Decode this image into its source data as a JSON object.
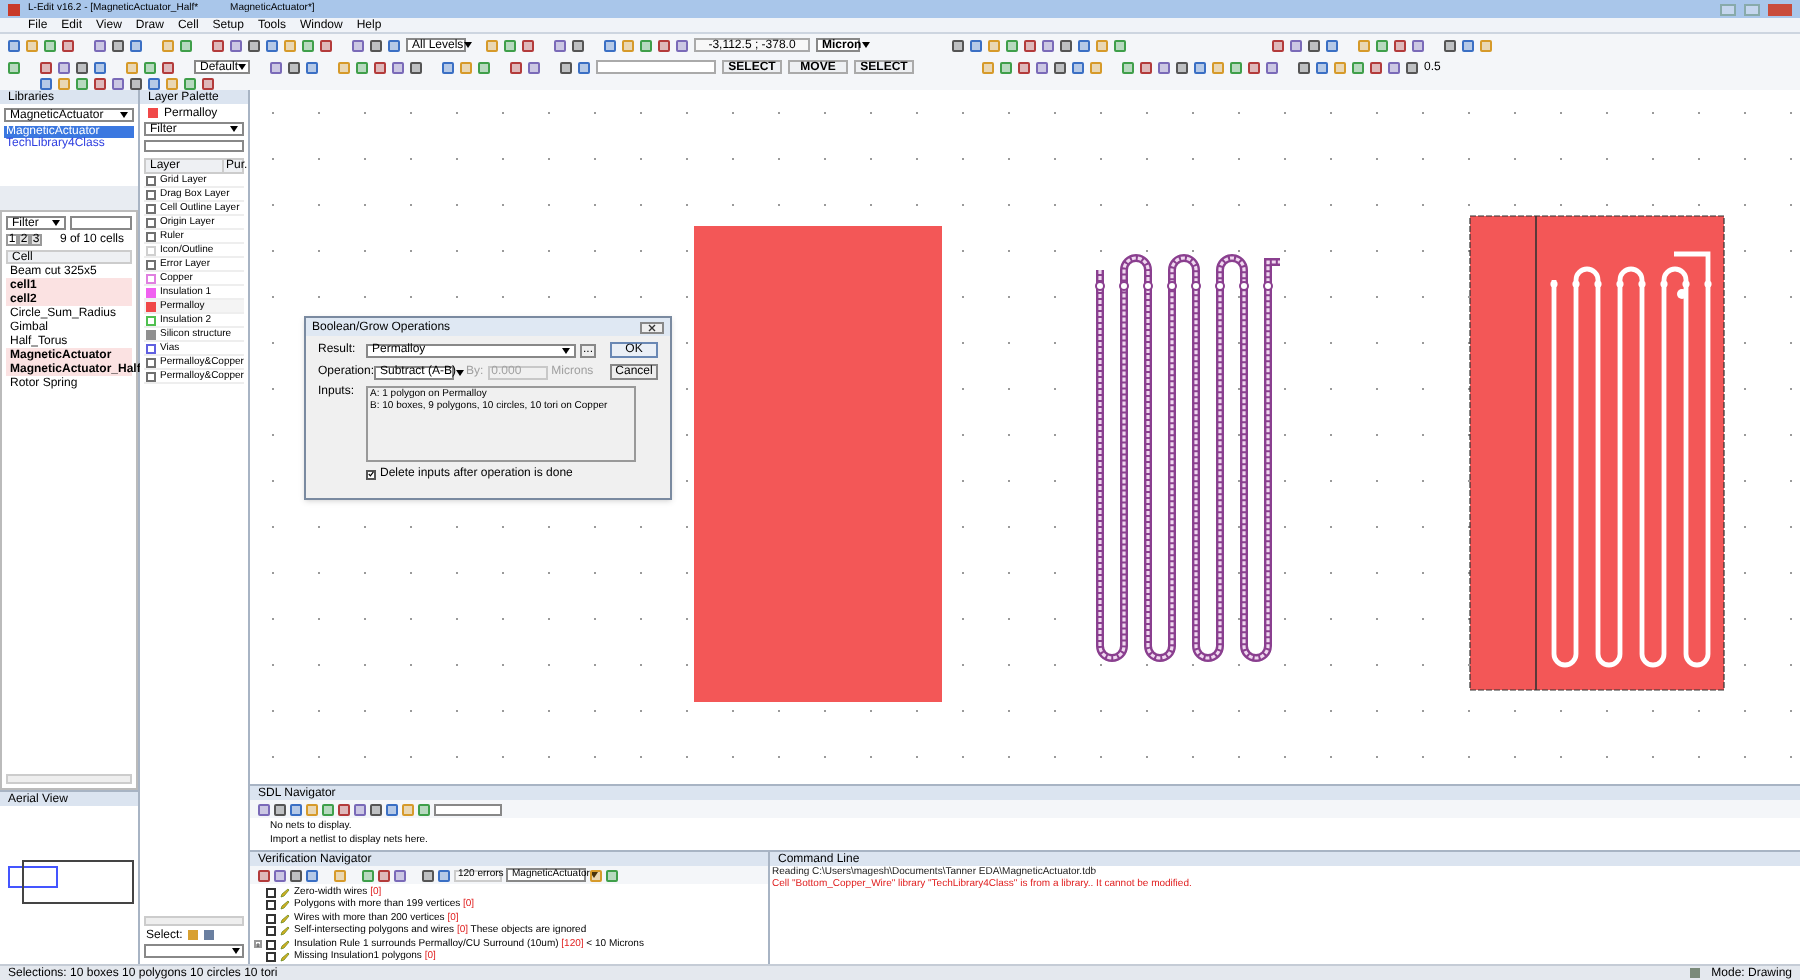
{
  "window": {
    "title": "L-Edit v16.2 - [MagneticActuator_Half*",
    "doc_tab": "MagneticActuator*]"
  },
  "menu": [
    "File",
    "Edit",
    "View",
    "Draw",
    "Cell",
    "Setup",
    "Tools",
    "Window",
    "Help"
  ],
  "toolbar": {
    "levels": "All Levels",
    "coordinates": "-3,112.5 ; -378.0",
    "units": "Micron",
    "style": "Default",
    "mouse_buttons": [
      "SELECT",
      "MOVE",
      "SELECT"
    ],
    "snap_value": "0.5"
  },
  "libraries": {
    "title": "Libraries",
    "library": "MagneticActuator",
    "items": [
      {
        "label": "MagneticActuator",
        "selected": true
      },
      {
        "label": "TechLibrary4Class",
        "selected": false
      }
    ]
  },
  "cells": {
    "filter": "Filter",
    "tabs": [
      {
        "label": "1",
        "selected": true
      },
      {
        "label": "2",
        "selected": false
      },
      {
        "label": "3",
        "selected": false
      }
    ],
    "count": "9 of 10 cells",
    "header": "Cell",
    "rows": [
      {
        "label": "Beam cut 325x5",
        "highlighted": false
      },
      {
        "label": "cell1",
        "highlighted": true
      },
      {
        "label": "cell2",
        "highlighted": true
      },
      {
        "label": "Circle_Sum_Radius",
        "highlighted": false
      },
      {
        "label": "Gimbal",
        "highlighted": false
      },
      {
        "label": "Half_Torus",
        "highlighted": false
      },
      {
        "label": "MagneticActuator",
        "highlighted": true
      },
      {
        "label": "MagneticActuator_Half",
        "highlighted": true
      },
      {
        "label": "Rotor Spring",
        "highlighted": false
      }
    ]
  },
  "aerial_view": {
    "title": "Aerial View"
  },
  "layer_palette": {
    "title": "Layer Palette",
    "current": {
      "label": "Permalloy",
      "color": "#f04848"
    },
    "filter": "Filter",
    "columns": [
      "Layer",
      "Pur."
    ],
    "select_label": "Select:",
    "layers": [
      {
        "label": "Grid Layer",
        "color": "#707070",
        "filled": false
      },
      {
        "label": "Drag Box Layer",
        "color": "#707070",
        "filled": false
      },
      {
        "label": "Cell Outline Layer",
        "color": "#707070",
        "filled": false
      },
      {
        "label": "Origin Layer",
        "color": "#707070",
        "filled": false
      },
      {
        "label": "Ruler",
        "color": "#707070",
        "filled": false
      },
      {
        "label": "Icon/Outline",
        "color": "#d0d0d0",
        "filled": false
      },
      {
        "label": "Error Layer",
        "color": "#707070",
        "filled": false
      },
      {
        "label": "Copper",
        "color": "#e080e0",
        "filled": false
      },
      {
        "label": "Insulation 1",
        "color": "#f060f0",
        "filled": true
      },
      {
        "label": "Permalloy",
        "color": "#f04848",
        "filled": true
      },
      {
        "label": "Insulation 2",
        "color": "#50c050",
        "filled": false
      },
      {
        "label": "Silicon structure",
        "color": "#909090",
        "filled": true
      },
      {
        "label": "Vias",
        "color": "#6060e0",
        "filled": false
      },
      {
        "label": "Permalloy&Copper",
        "color": "#707070",
        "filled": false
      },
      {
        "label": "Permalloy&Copper",
        "color": "#707070",
        "filled": false
      }
    ]
  },
  "dialog": {
    "title": "Boolean/Grow Operations",
    "result_label": "Result:",
    "result": "Permalloy",
    "browse": "...",
    "ok": "OK",
    "cancel": "Cancel",
    "operation_label": "Operation:",
    "operation": "Subtract (A-B)",
    "by_label": "By:",
    "by_value": "0.000",
    "by_units": "Microns",
    "by_disabled": true,
    "inputs_label": "Inputs:",
    "inputs": [
      "A: 1 polygon on Permalloy",
      "B: 10 boxes, 9 polygons, 10 circles, 10 tori on Copper"
    ],
    "delete_inputs": {
      "label": "Delete inputs after operation is done",
      "checked": true
    }
  },
  "sdl_navigator": {
    "title": "SDL Navigator",
    "messages": [
      "No nets to display.",
      "Import a netlist to display nets here."
    ]
  },
  "verification_navigator": {
    "title": "Verification Navigator",
    "errors": "120 errors",
    "cell": "MagneticActuator",
    "items": [
      {
        "label": "Zero-width wires",
        "count": "[0]",
        "checked": false,
        "expandable": false
      },
      {
        "label": "Polygons with more than 199 vertices",
        "count": "[0]",
        "checked": false,
        "expandable": false
      },
      {
        "label": "Wires with more than 200 vertices",
        "count": "[0]",
        "checked": false,
        "expandable": false
      },
      {
        "label": "Self-intersecting polygons and wires",
        "count": "[0]",
        "suffix": "These objects are ignored",
        "checked": false,
        "expandable": false
      },
      {
        "label": "Insulation Rule 1 surrounds Permalloy/CU Surround (10um)",
        "count": "[120]",
        "suffix": "< 10 Microns",
        "checked": false,
        "expandable": true
      },
      {
        "label": "Missing Insulation1 polygons",
        "count": "[0]",
        "checked": false,
        "expandable": false
      }
    ]
  },
  "command_line": {
    "title": "Command Line",
    "lines": [
      {
        "kind": "info",
        "text": "Reading C:\\Users\\magesh\\Documents\\Tanner EDA\\MagneticActuator.tdb"
      },
      {
        "kind": "error",
        "text": "Cell \"Bottom_Copper_Wire\" library \"TechLibrary4Class\" is from a library.. It cannot be modified."
      }
    ]
  },
  "status_bar": {
    "selection": "Selections: 10 boxes 10 polygons 10 circles 10 tori",
    "mode": "Mode: Drawing"
  }
}
